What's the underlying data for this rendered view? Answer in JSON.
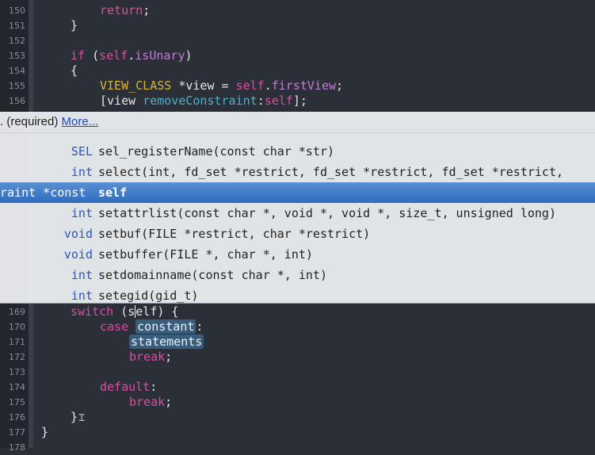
{
  "editor": {
    "lines": [
      {
        "num": "150",
        "indent": 2,
        "parts": [
          {
            "t": "return",
            "c": "kw"
          },
          {
            "t": ";",
            "c": ""
          }
        ]
      },
      {
        "num": "151",
        "indent": 1,
        "parts": [
          {
            "t": "}",
            "c": ""
          }
        ]
      },
      {
        "num": "152",
        "indent": 0,
        "parts": []
      },
      {
        "num": "153",
        "indent": 1,
        "parts": [
          {
            "t": "if",
            "c": "kw"
          },
          {
            "t": " (",
            "c": ""
          },
          {
            "t": "self",
            "c": "self"
          },
          {
            "t": ".",
            "c": ""
          },
          {
            "t": "isUnary",
            "c": "prop"
          },
          {
            "t": ")",
            "c": ""
          }
        ]
      },
      {
        "num": "154",
        "indent": 1,
        "parts": [
          {
            "t": "{",
            "c": ""
          }
        ]
      },
      {
        "num": "155",
        "indent": 2,
        "parts": [
          {
            "t": "VIEW_CLASS",
            "c": "macro"
          },
          {
            "t": " *view = ",
            "c": ""
          },
          {
            "t": "self",
            "c": "self"
          },
          {
            "t": ".",
            "c": ""
          },
          {
            "t": "firstView",
            "c": "prop"
          },
          {
            "t": ";",
            "c": ""
          }
        ]
      },
      {
        "num": "156",
        "indent": 2,
        "parts": [
          {
            "t": "[view ",
            "c": ""
          },
          {
            "t": "removeConstraint",
            "c": "method"
          },
          {
            "t": ":",
            "c": ""
          },
          {
            "t": "self",
            "c": "self"
          },
          {
            "t": "];",
            "c": ""
          }
        ]
      },
      {
        "num": "169",
        "indent": 1,
        "parts": [
          {
            "t": "switch",
            "c": "kw"
          },
          {
            "t": " (s",
            "c": ""
          },
          {
            "t": "|",
            "c": "cursor"
          },
          {
            "t": "elf) {",
            "c": ""
          }
        ]
      },
      {
        "num": "170",
        "indent": 2,
        "parts": [
          {
            "t": "case",
            "c": "kw"
          },
          {
            "t": " ",
            "c": ""
          },
          {
            "t": "constant",
            "c": "tok"
          },
          {
            "t": ":",
            "c": ""
          }
        ]
      },
      {
        "num": "171",
        "indent": 3,
        "parts": [
          {
            "t": "statements",
            "c": "tok"
          }
        ]
      },
      {
        "num": "172",
        "indent": 3,
        "parts": [
          {
            "t": "break",
            "c": "kw"
          },
          {
            "t": ";",
            "c": ""
          }
        ]
      },
      {
        "num": "173",
        "indent": 0,
        "parts": []
      },
      {
        "num": "174",
        "indent": 2,
        "parts": [
          {
            "t": "default",
            "c": "kw"
          },
          {
            "t": ":",
            "c": ""
          }
        ]
      },
      {
        "num": "175",
        "indent": 3,
        "parts": [
          {
            "t": "break",
            "c": "kw"
          },
          {
            "t": ";",
            "c": ""
          }
        ]
      },
      {
        "num": "176",
        "indent": 1,
        "parts": [
          {
            "t": "}",
            "c": ""
          }
        ]
      },
      {
        "num": "177",
        "indent": 0,
        "parts": [
          {
            "t": "}",
            "c": ""
          }
        ]
      },
      {
        "num": "178",
        "indent": 0,
        "parts": []
      }
    ]
  },
  "completion": {
    "header_text": ". (required) ",
    "more_link": "More...",
    "items": [
      {
        "type": "SEL",
        "sig": "sel_registerName(const char *str)",
        "selected": false
      },
      {
        "type": "int",
        "sig": "select(int, fd_set *restrict, fd_set *restrict, fd_set *restrict,",
        "selected": false
      },
      {
        "type": "raint *const",
        "sig": "self",
        "selected": true
      },
      {
        "type": "int",
        "sig": "setattrlist(const char *, void *, void *, size_t, unsigned long)",
        "selected": false
      },
      {
        "type": "void",
        "sig": "setbuf(FILE *restrict, char *restrict)",
        "selected": false
      },
      {
        "type": "void",
        "sig": "setbuffer(FILE *, char *, int)",
        "selected": false
      },
      {
        "type": "int",
        "sig": "setdomainname(const char *, int)",
        "selected": false
      },
      {
        "type": "int",
        "sig": "setegid(gid_t)",
        "selected": false
      }
    ]
  },
  "colors": {
    "background": "#2b2f37",
    "keyword": "#d84ea0",
    "macro": "#d9b53a",
    "method": "#4fb0c6",
    "property": "#c37bd6",
    "selection": "#2f6cbf"
  }
}
